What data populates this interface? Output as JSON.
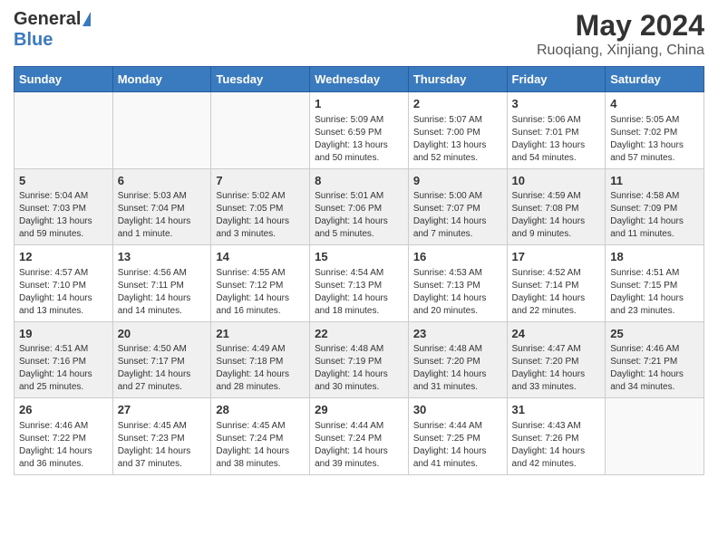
{
  "header": {
    "logo_general": "General",
    "logo_blue": "Blue",
    "main_title": "May 2024",
    "subtitle": "Ruoqiang, Xinjiang, China"
  },
  "calendar": {
    "days_of_week": [
      "Sunday",
      "Monday",
      "Tuesday",
      "Wednesday",
      "Thursday",
      "Friday",
      "Saturday"
    ],
    "weeks": [
      [
        {
          "day": "",
          "sunrise": "",
          "sunset": "",
          "daylight": ""
        },
        {
          "day": "",
          "sunrise": "",
          "sunset": "",
          "daylight": ""
        },
        {
          "day": "",
          "sunrise": "",
          "sunset": "",
          "daylight": ""
        },
        {
          "day": "1",
          "sunrise": "Sunrise: 5:09 AM",
          "sunset": "Sunset: 6:59 PM",
          "daylight": "Daylight: 13 hours and 50 minutes."
        },
        {
          "day": "2",
          "sunrise": "Sunrise: 5:07 AM",
          "sunset": "Sunset: 7:00 PM",
          "daylight": "Daylight: 13 hours and 52 minutes."
        },
        {
          "day": "3",
          "sunrise": "Sunrise: 5:06 AM",
          "sunset": "Sunset: 7:01 PM",
          "daylight": "Daylight: 13 hours and 54 minutes."
        },
        {
          "day": "4",
          "sunrise": "Sunrise: 5:05 AM",
          "sunset": "Sunset: 7:02 PM",
          "daylight": "Daylight: 13 hours and 57 minutes."
        }
      ],
      [
        {
          "day": "5",
          "sunrise": "Sunrise: 5:04 AM",
          "sunset": "Sunset: 7:03 PM",
          "daylight": "Daylight: 13 hours and 59 minutes."
        },
        {
          "day": "6",
          "sunrise": "Sunrise: 5:03 AM",
          "sunset": "Sunset: 7:04 PM",
          "daylight": "Daylight: 14 hours and 1 minute."
        },
        {
          "day": "7",
          "sunrise": "Sunrise: 5:02 AM",
          "sunset": "Sunset: 7:05 PM",
          "daylight": "Daylight: 14 hours and 3 minutes."
        },
        {
          "day": "8",
          "sunrise": "Sunrise: 5:01 AM",
          "sunset": "Sunset: 7:06 PM",
          "daylight": "Daylight: 14 hours and 5 minutes."
        },
        {
          "day": "9",
          "sunrise": "Sunrise: 5:00 AM",
          "sunset": "Sunset: 7:07 PM",
          "daylight": "Daylight: 14 hours and 7 minutes."
        },
        {
          "day": "10",
          "sunrise": "Sunrise: 4:59 AM",
          "sunset": "Sunset: 7:08 PM",
          "daylight": "Daylight: 14 hours and 9 minutes."
        },
        {
          "day": "11",
          "sunrise": "Sunrise: 4:58 AM",
          "sunset": "Sunset: 7:09 PM",
          "daylight": "Daylight: 14 hours and 11 minutes."
        }
      ],
      [
        {
          "day": "12",
          "sunrise": "Sunrise: 4:57 AM",
          "sunset": "Sunset: 7:10 PM",
          "daylight": "Daylight: 14 hours and 13 minutes."
        },
        {
          "day": "13",
          "sunrise": "Sunrise: 4:56 AM",
          "sunset": "Sunset: 7:11 PM",
          "daylight": "Daylight: 14 hours and 14 minutes."
        },
        {
          "day": "14",
          "sunrise": "Sunrise: 4:55 AM",
          "sunset": "Sunset: 7:12 PM",
          "daylight": "Daylight: 14 hours and 16 minutes."
        },
        {
          "day": "15",
          "sunrise": "Sunrise: 4:54 AM",
          "sunset": "Sunset: 7:13 PM",
          "daylight": "Daylight: 14 hours and 18 minutes."
        },
        {
          "day": "16",
          "sunrise": "Sunrise: 4:53 AM",
          "sunset": "Sunset: 7:13 PM",
          "daylight": "Daylight: 14 hours and 20 minutes."
        },
        {
          "day": "17",
          "sunrise": "Sunrise: 4:52 AM",
          "sunset": "Sunset: 7:14 PM",
          "daylight": "Daylight: 14 hours and 22 minutes."
        },
        {
          "day": "18",
          "sunrise": "Sunrise: 4:51 AM",
          "sunset": "Sunset: 7:15 PM",
          "daylight": "Daylight: 14 hours and 23 minutes."
        }
      ],
      [
        {
          "day": "19",
          "sunrise": "Sunrise: 4:51 AM",
          "sunset": "Sunset: 7:16 PM",
          "daylight": "Daylight: 14 hours and 25 minutes."
        },
        {
          "day": "20",
          "sunrise": "Sunrise: 4:50 AM",
          "sunset": "Sunset: 7:17 PM",
          "daylight": "Daylight: 14 hours and 27 minutes."
        },
        {
          "day": "21",
          "sunrise": "Sunrise: 4:49 AM",
          "sunset": "Sunset: 7:18 PM",
          "daylight": "Daylight: 14 hours and 28 minutes."
        },
        {
          "day": "22",
          "sunrise": "Sunrise: 4:48 AM",
          "sunset": "Sunset: 7:19 PM",
          "daylight": "Daylight: 14 hours and 30 minutes."
        },
        {
          "day": "23",
          "sunrise": "Sunrise: 4:48 AM",
          "sunset": "Sunset: 7:20 PM",
          "daylight": "Daylight: 14 hours and 31 minutes."
        },
        {
          "day": "24",
          "sunrise": "Sunrise: 4:47 AM",
          "sunset": "Sunset: 7:20 PM",
          "daylight": "Daylight: 14 hours and 33 minutes."
        },
        {
          "day": "25",
          "sunrise": "Sunrise: 4:46 AM",
          "sunset": "Sunset: 7:21 PM",
          "daylight": "Daylight: 14 hours and 34 minutes."
        }
      ],
      [
        {
          "day": "26",
          "sunrise": "Sunrise: 4:46 AM",
          "sunset": "Sunset: 7:22 PM",
          "daylight": "Daylight: 14 hours and 36 minutes."
        },
        {
          "day": "27",
          "sunrise": "Sunrise: 4:45 AM",
          "sunset": "Sunset: 7:23 PM",
          "daylight": "Daylight: 14 hours and 37 minutes."
        },
        {
          "day": "28",
          "sunrise": "Sunrise: 4:45 AM",
          "sunset": "Sunset: 7:24 PM",
          "daylight": "Daylight: 14 hours and 38 minutes."
        },
        {
          "day": "29",
          "sunrise": "Sunrise: 4:44 AM",
          "sunset": "Sunset: 7:24 PM",
          "daylight": "Daylight: 14 hours and 39 minutes."
        },
        {
          "day": "30",
          "sunrise": "Sunrise: 4:44 AM",
          "sunset": "Sunset: 7:25 PM",
          "daylight": "Daylight: 14 hours and 41 minutes."
        },
        {
          "day": "31",
          "sunrise": "Sunrise: 4:43 AM",
          "sunset": "Sunset: 7:26 PM",
          "daylight": "Daylight: 14 hours and 42 minutes."
        },
        {
          "day": "",
          "sunrise": "",
          "sunset": "",
          "daylight": ""
        }
      ]
    ]
  }
}
